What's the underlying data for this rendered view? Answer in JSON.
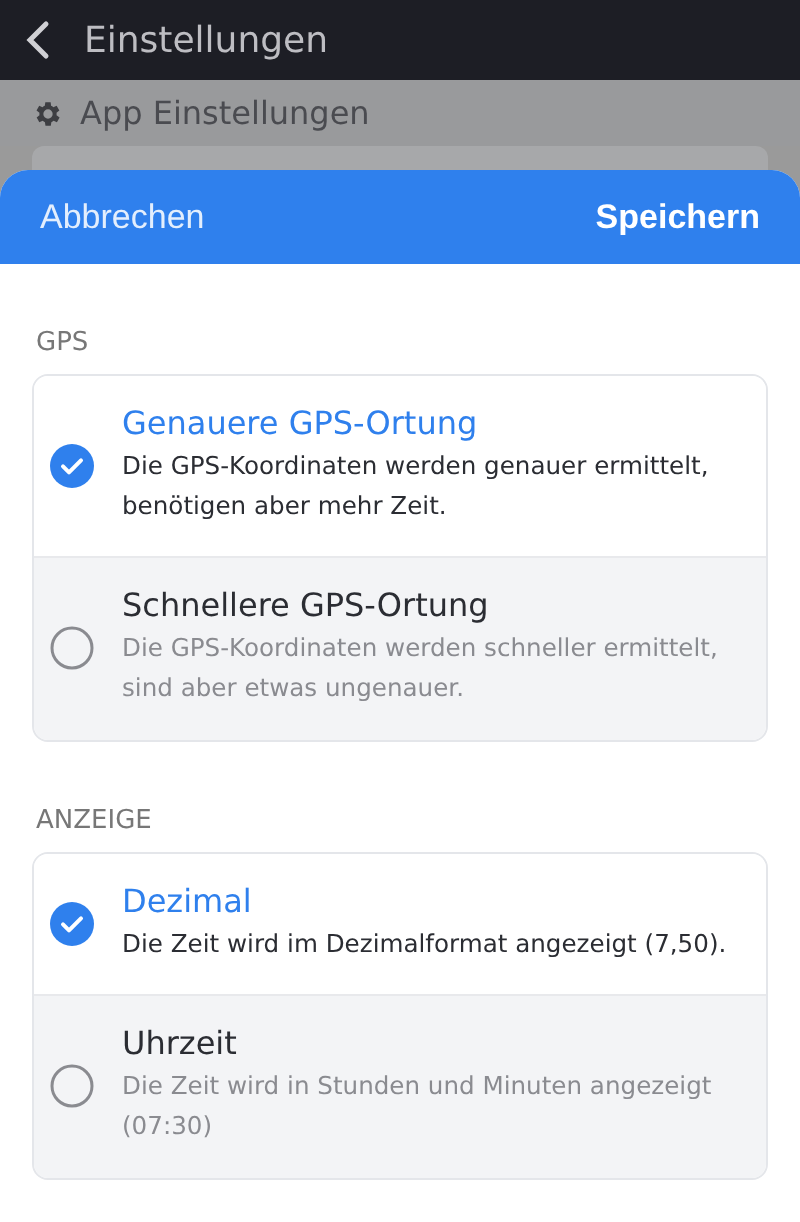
{
  "top_bar": {
    "title": "Einstellungen"
  },
  "background_page": {
    "heading": "App Einstellungen"
  },
  "sheet": {
    "cancel": "Abbrechen",
    "save": "Speichern"
  },
  "sections": [
    {
      "title": "GPS",
      "options": [
        {
          "title": "Genauere GPS-Ortung",
          "description": "Die GPS-Koordinaten werden genauer ermittelt, benötigen aber mehr Zeit.",
          "selected": true
        },
        {
          "title": "Schnellere GPS-Ortung",
          "description": "Die GPS-Koordinaten werden schneller ermittelt, sind aber etwas ungenauer.",
          "selected": false
        }
      ]
    },
    {
      "title": "ANZEIGE",
      "options": [
        {
          "title": "Dezimal",
          "description": "Die Zeit wird im Dezimalformat angezeigt (7,50).",
          "selected": true
        },
        {
          "title": "Uhrzeit",
          "description": "Die Zeit wird in Stunden und Minuten angezeigt (07:30)",
          "selected": false
        }
      ]
    }
  ]
}
